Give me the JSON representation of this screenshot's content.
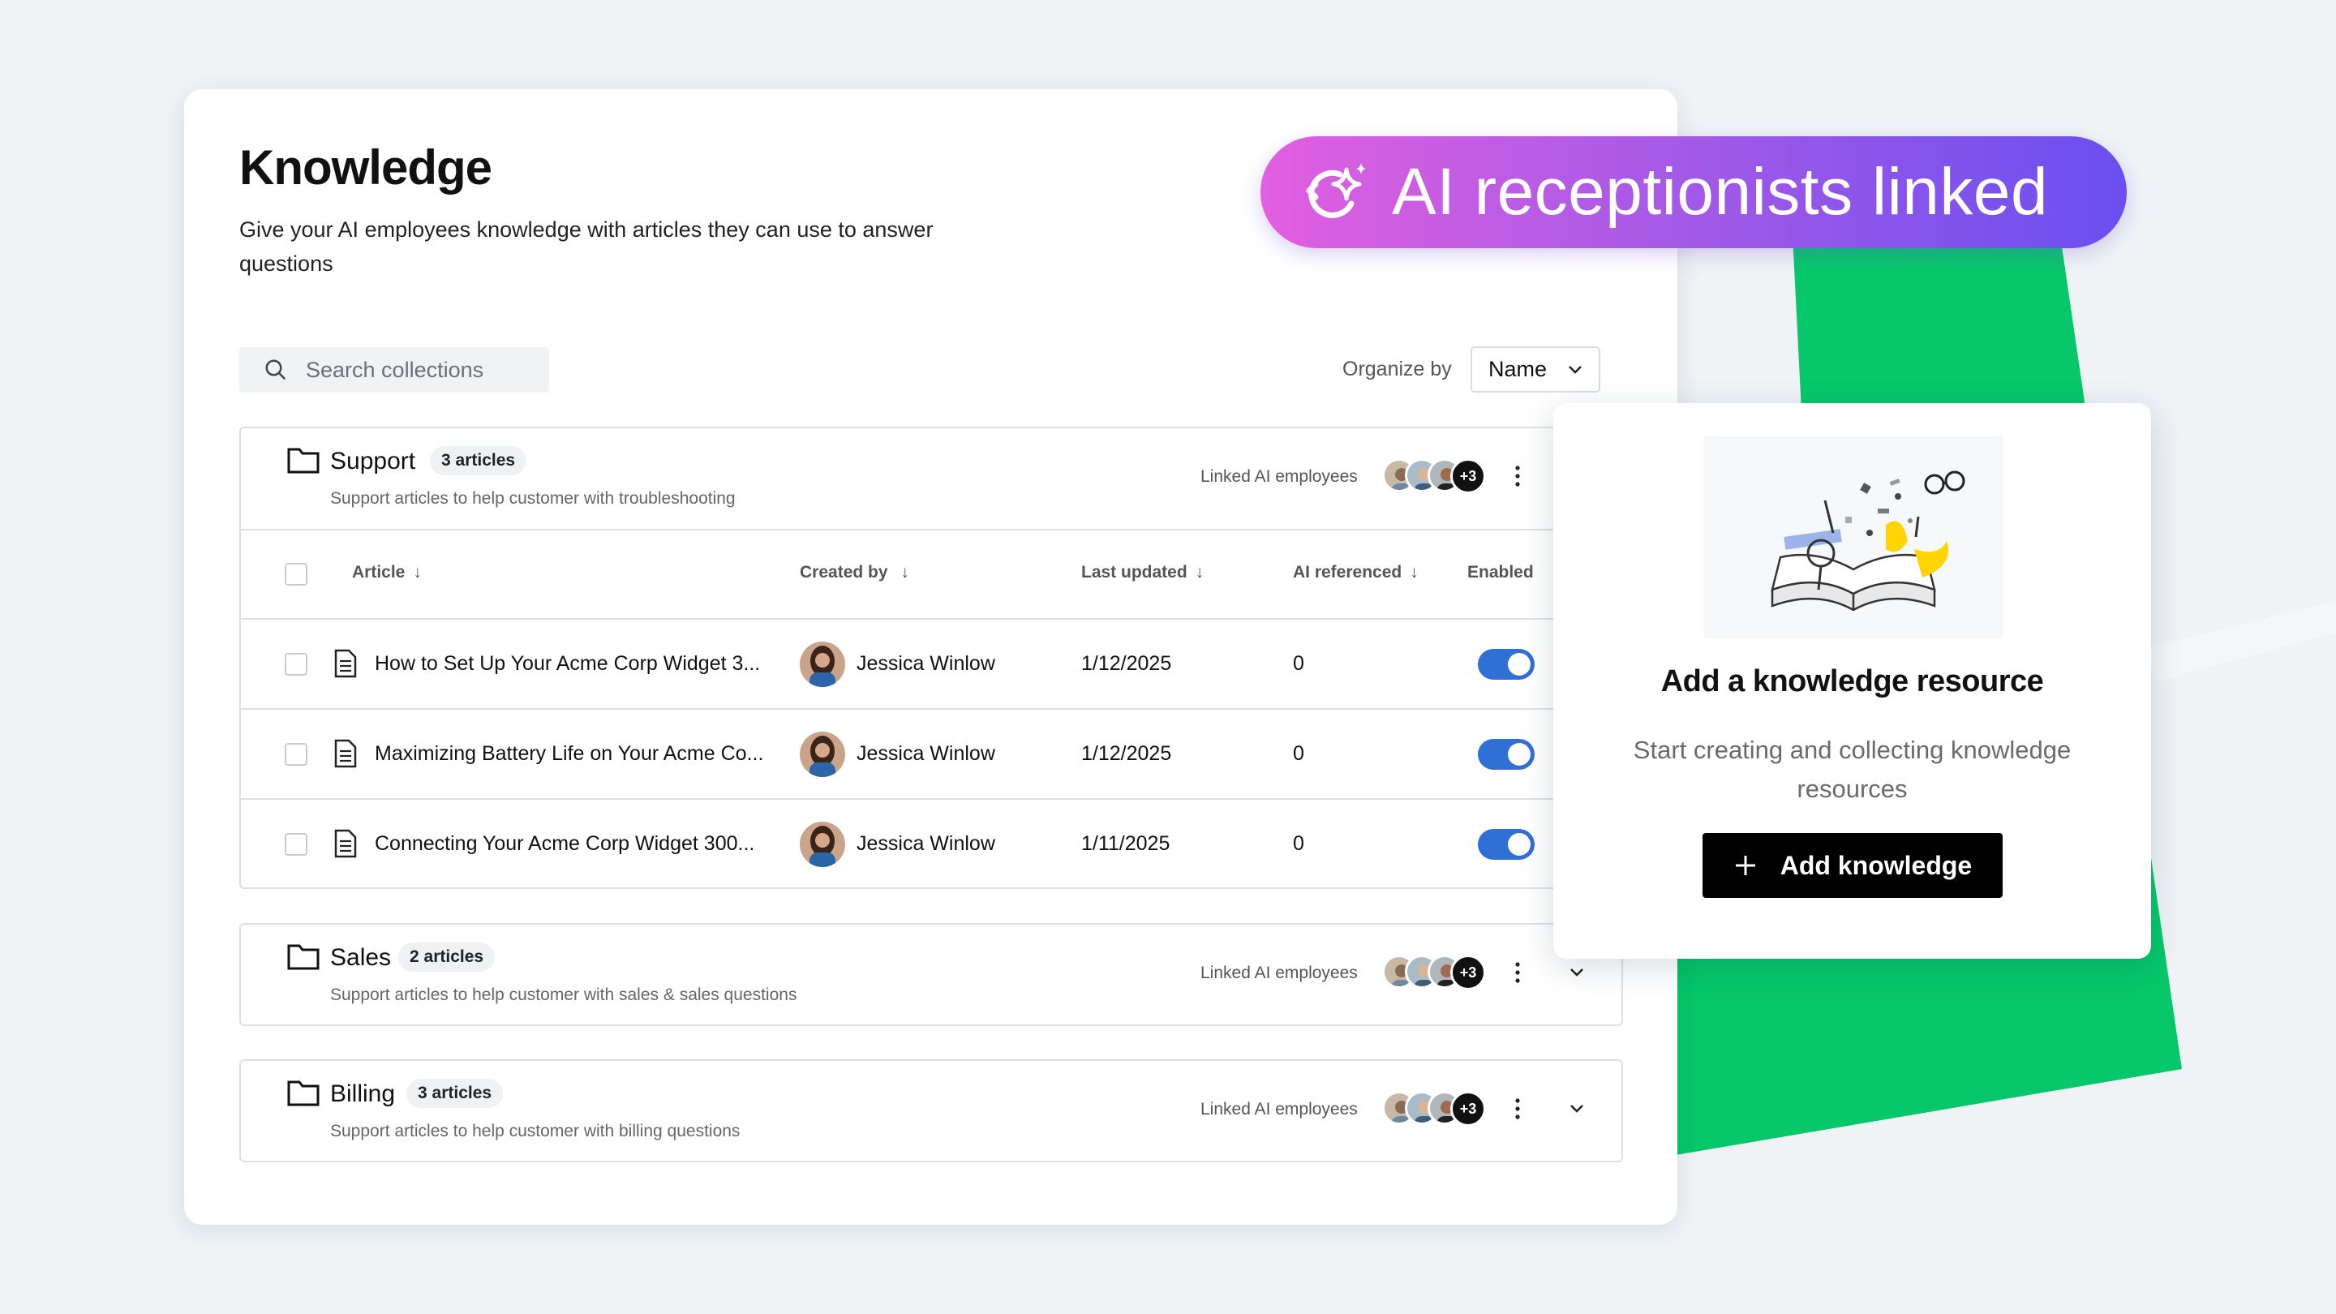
{
  "colors": {
    "accent_green": "#06c76a",
    "toggle_blue": "#2f6fd6",
    "pill_gradient": [
      "#e25fe0",
      "#a85ae6",
      "#6b4ff0"
    ]
  },
  "header": {
    "title": "Knowledge",
    "subtitle": "Give your AI employees knowledge with articles they can use to answer questions"
  },
  "search": {
    "placeholder": "Search collections",
    "icon": "search-icon"
  },
  "organize": {
    "label": "Organize by",
    "value": "Name"
  },
  "table": {
    "columns": {
      "article": "Article",
      "created_by": "Created by",
      "last_updated": "Last updated",
      "ai_referenced": "AI referenced",
      "enabled": "Enabled"
    }
  },
  "groups": [
    {
      "name": "Support",
      "badge": "3 articles",
      "description": "Support articles to help customer with troubleshooting",
      "linked_label": "Linked AI employees",
      "more": "+3",
      "rows": [
        {
          "article": "How to Set Up Your Acme Corp Widget 3...",
          "created_by": "Jessica Winlow",
          "last_updated": "1/12/2025",
          "ai_referenced": "0",
          "enabled": true
        },
        {
          "article": "Maximizing Battery Life on Your Acme Co...",
          "created_by": "Jessica Winlow",
          "last_updated": "1/12/2025",
          "ai_referenced": "0",
          "enabled": true
        },
        {
          "article": "Connecting Your Acme Corp Widget 300...",
          "created_by": "Jessica Winlow",
          "last_updated": "1/11/2025",
          "ai_referenced": "0",
          "enabled": true
        }
      ]
    },
    {
      "name": "Sales",
      "badge": "2 articles",
      "description": "Support articles to help customer with sales & sales questions",
      "linked_label": "Linked AI employees",
      "more": "+3"
    },
    {
      "name": "Billing",
      "badge": "3 articles",
      "description": "Support articles to help customer with billing questions",
      "linked_label": "Linked AI employees",
      "more": "+3"
    }
  ],
  "side_card": {
    "title": "Add a knowledge resource",
    "description": "Start creating and collecting knowledge resources",
    "button": "Add knowledge"
  },
  "pill": {
    "text": "AI receptionists linked",
    "icon": "sparkle-refresh-icon"
  }
}
